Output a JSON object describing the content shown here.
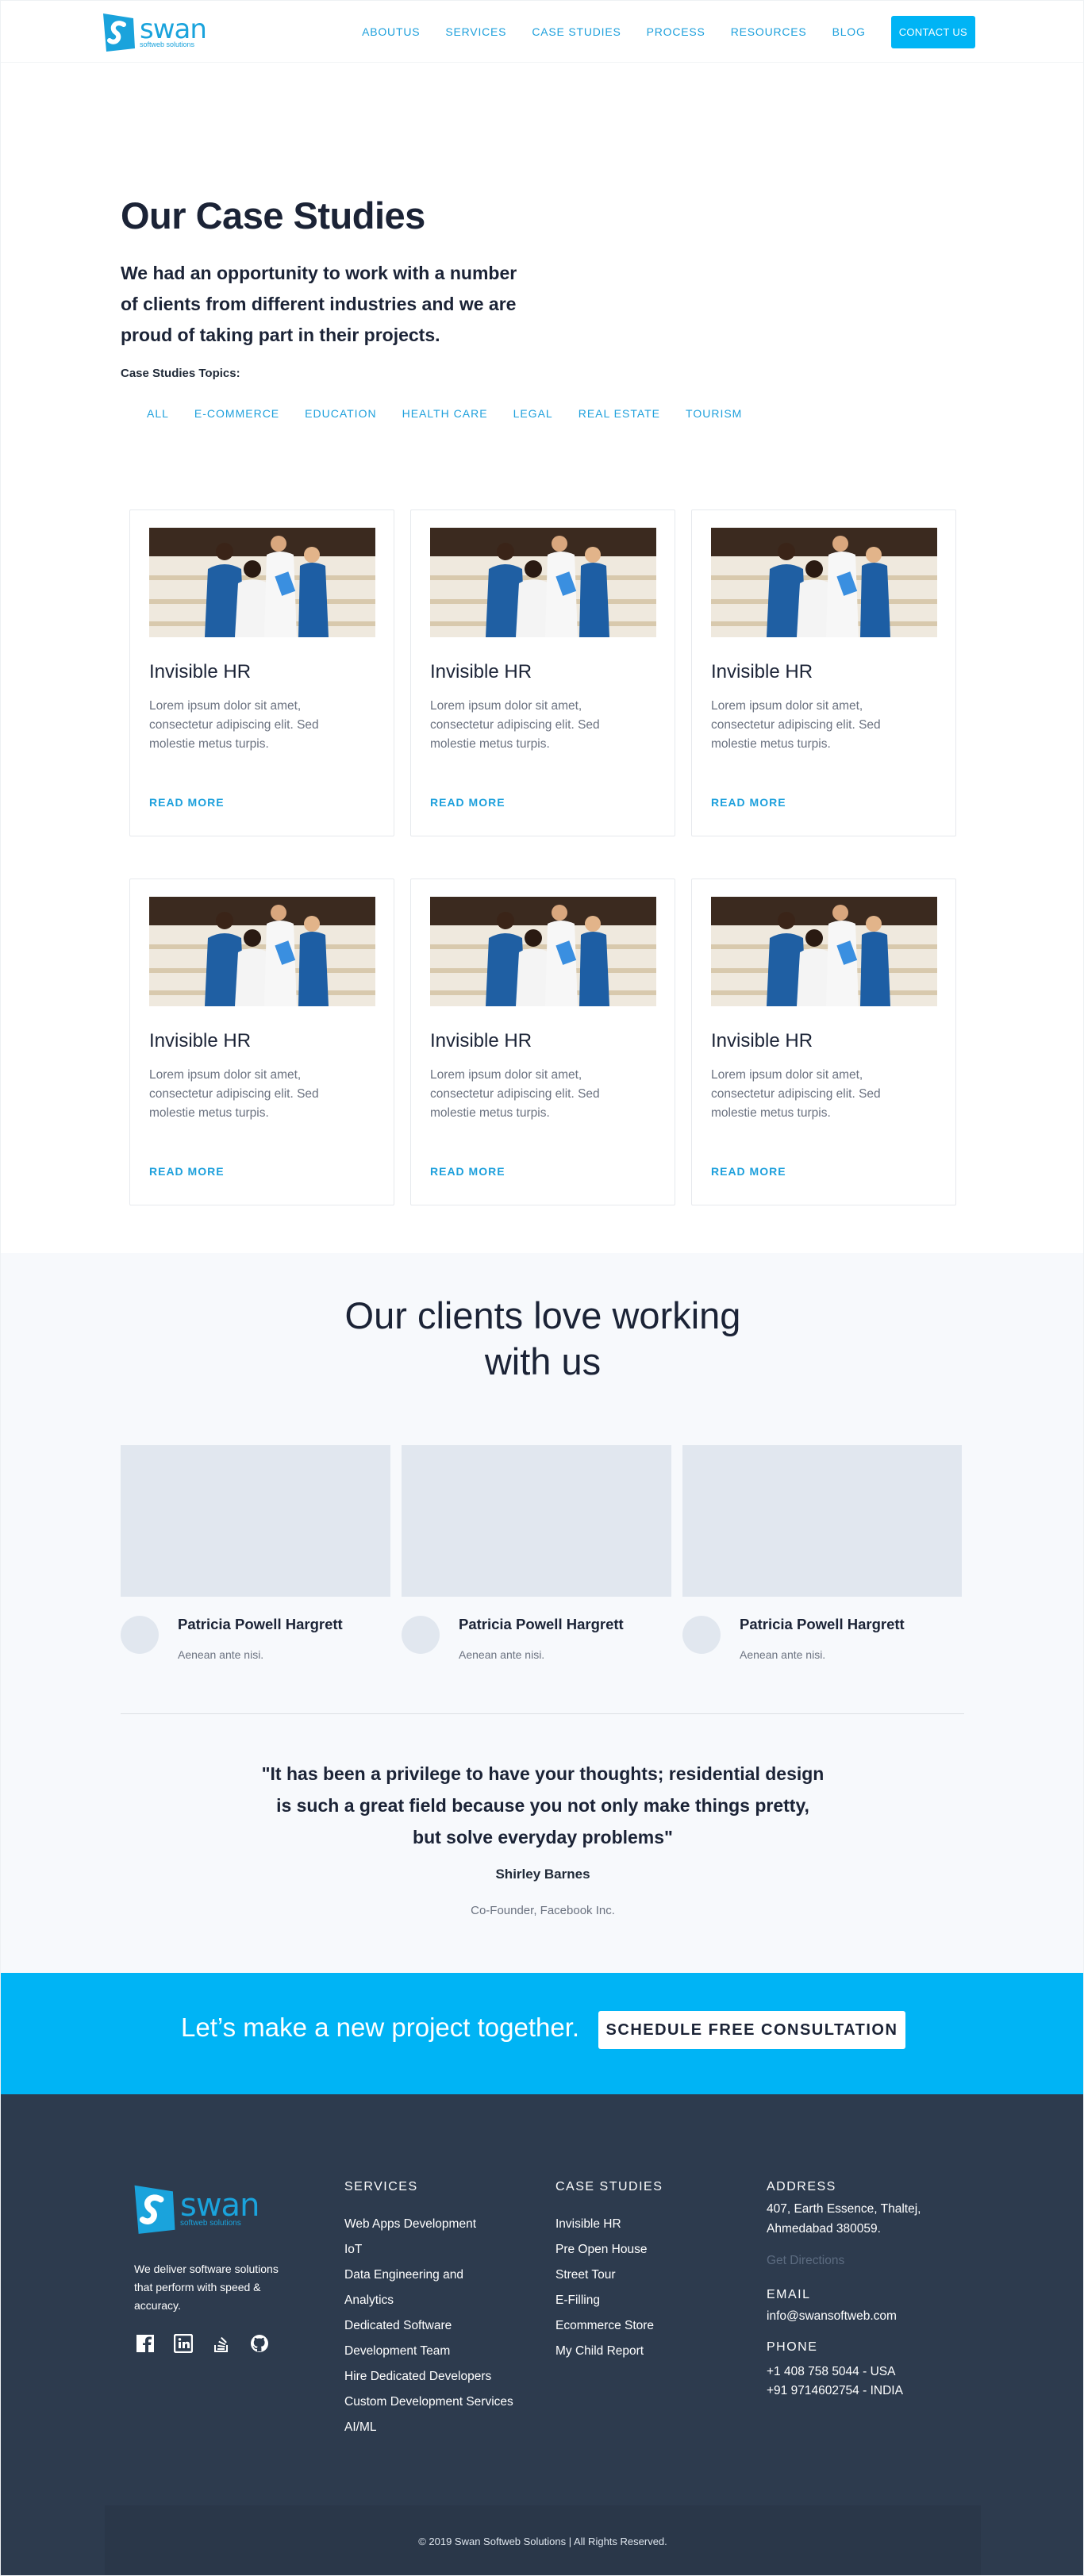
{
  "header": {
    "logo_text": "swan",
    "logo_sub": "softweb solutions",
    "nav": [
      "ABOUTUS",
      "SERVICES",
      "CASE STUDIES",
      "PROCESS",
      "RESOURCES",
      "BLOG"
    ],
    "contact": "CONTACT US"
  },
  "hero": {
    "title": "Our Case Studies",
    "lead_1": "We had an opportunity to work with a number",
    "lead_2": "of clients from different industries and we are",
    "lead_3": "proud of taking part in their projects.",
    "topics_label": "Case Studies Topics:",
    "filters": [
      "ALL",
      "E-COMMERCE",
      "EDUCATION",
      "HEALTH CARE",
      "LEGAL",
      "REAL ESTATE",
      "TOURISM"
    ]
  },
  "cards": [
    {
      "title": "Invisible HR",
      "text_1": "Lorem ipsum dolor sit amet,",
      "text_2": "consectetur adipiscing elit. Sed",
      "text_3": "molestie metus turpis.",
      "link": "READ MORE"
    },
    {
      "title": "Invisible HR",
      "text_1": "Lorem ipsum dolor sit amet,",
      "text_2": "consectetur adipiscing elit. Sed",
      "text_3": "molestie metus turpis.",
      "link": "READ MORE"
    },
    {
      "title": "Invisible HR",
      "text_1": "Lorem ipsum dolor sit amet,",
      "text_2": "consectetur adipiscing elit. Sed",
      "text_3": "molestie metus turpis.",
      "link": "READ MORE"
    },
    {
      "title": "Invisible HR",
      "text_1": "Lorem ipsum dolor sit amet,",
      "text_2": "consectetur adipiscing elit. Sed",
      "text_3": "molestie metus turpis.",
      "link": "READ MORE"
    },
    {
      "title": "Invisible HR",
      "text_1": "Lorem ipsum dolor sit amet,",
      "text_2": "consectetur adipiscing elit. Sed",
      "text_3": "molestie metus turpis.",
      "link": "READ MORE"
    },
    {
      "title": "Invisible HR",
      "text_1": "Lorem ipsum dolor sit amet,",
      "text_2": "consectetur adipiscing elit. Sed",
      "text_3": "molestie metus turpis.",
      "link": "READ MORE"
    }
  ],
  "testimonials": {
    "heading_1": "Our clients love working",
    "heading_2": "with us",
    "people": [
      {
        "name": "Patricia Powell Hargrett",
        "role": "Aenean ante nisi."
      },
      {
        "name": "Patricia Powell Hargrett",
        "role": "Aenean ante nisi."
      },
      {
        "name": "Patricia Powell Hargrett",
        "role": "Aenean ante nisi."
      }
    ],
    "quote_1": "\"It has been a privilege to have your thoughts; residential design",
    "quote_2": "is such a great field because you not only make things pretty,",
    "quote_3": "but solve everyday problems\"",
    "quote_name": "Shirley Barnes",
    "quote_role": "Co-Founder, Facebook Inc."
  },
  "cta_band": {
    "text": "Let’s make a new project together.",
    "button": "SCHEDULE FREE CONSULTATION"
  },
  "footer": {
    "desc_1": "We deliver software solutions",
    "desc_2": "that perform with speed &",
    "desc_3": "accuracy.",
    "social_icons": [
      "facebook-icon",
      "linkedin-icon",
      "stackoverflow-icon",
      "github-icon"
    ],
    "services_title": "SERVICES",
    "services": [
      "Web Apps Development",
      "IoT",
      "Data Engineering and",
      "Analytics",
      "Dedicated Software",
      "Development Team",
      "Hire Dedicated Developers",
      "Custom Development Services",
      "AI/ML"
    ],
    "cases_title": "CASE STUDIES",
    "cases": [
      "Invisible HR",
      "Pre Open House",
      "Street Tour",
      "E-Filling",
      "Ecommerce Store",
      "My Child Report"
    ],
    "address_title": "ADDRESS",
    "address_1": "407, Earth Essence, Thaltej,",
    "address_2": "Ahmedabad 380059.",
    "directions": "Get Directions",
    "email_title": "EMAIL",
    "email": "info@swansoftweb.com",
    "phone_title": "PHONE",
    "phone_1": "+1 408 758 5044 - USA",
    "phone_2": "+91 9714602754 - INDIA",
    "copyright": "© 2019 Swan Softweb Solutions | All Rights Reserved."
  },
  "colors": {
    "accent": "#00b4f5",
    "link": "#1ea0dc",
    "footer_bg": "#2d3b4e",
    "section_bg": "#f7f9fc"
  }
}
